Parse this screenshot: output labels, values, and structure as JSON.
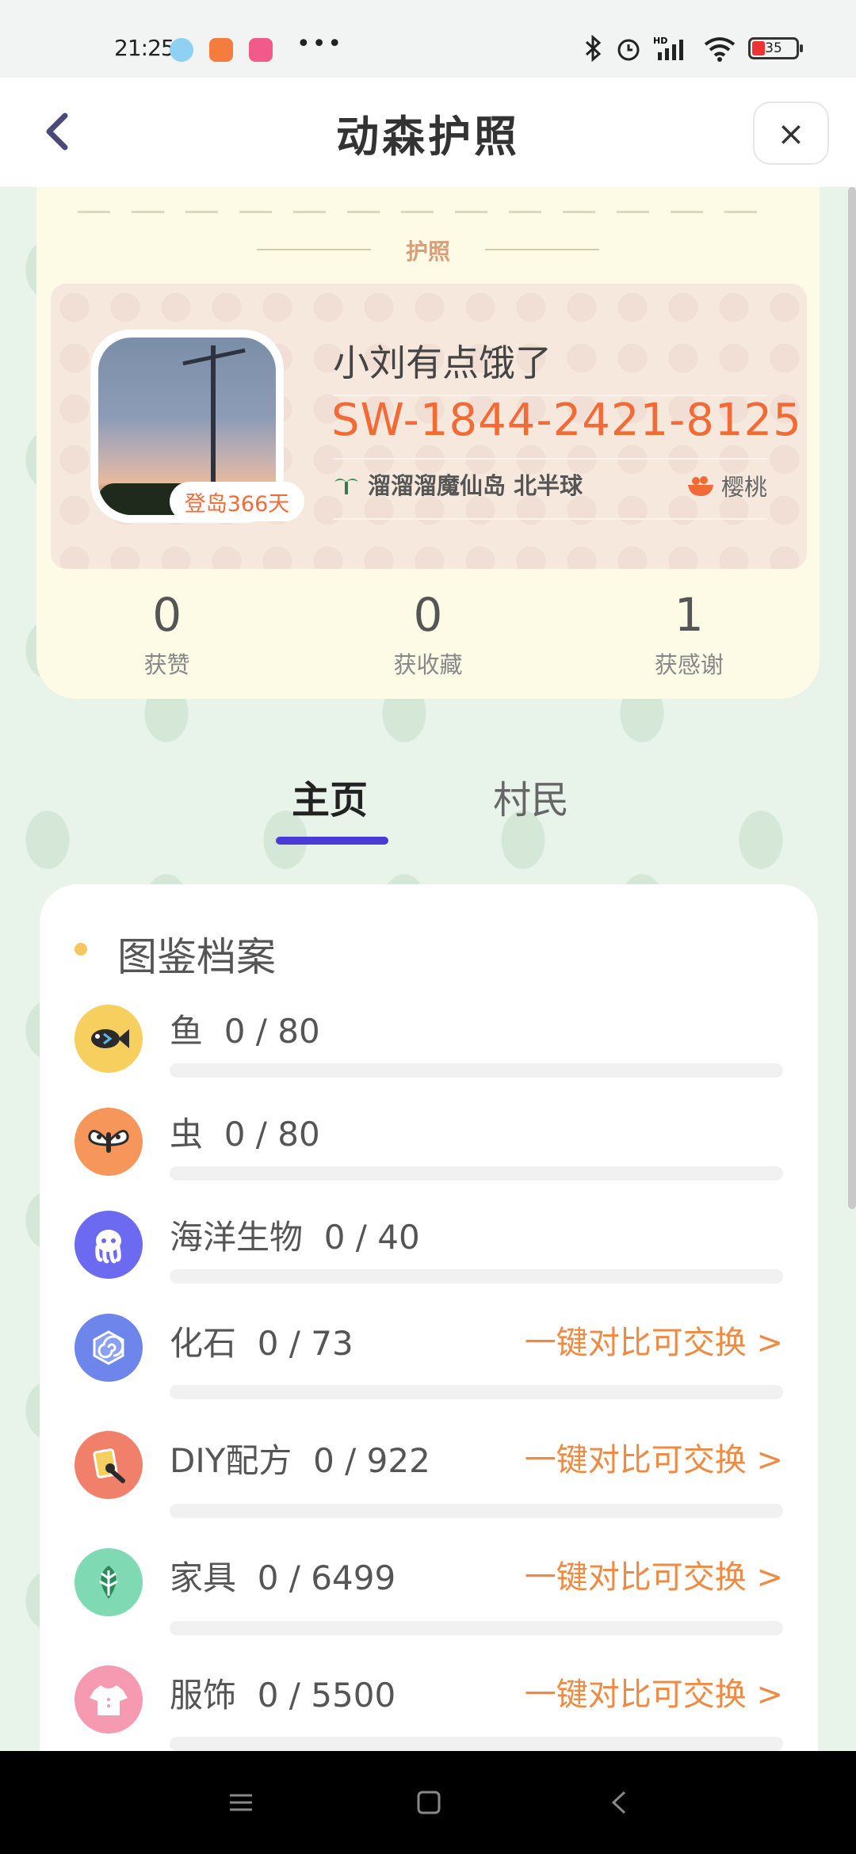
{
  "status_bar": {
    "time": "21:25",
    "battery": "35",
    "more": "•••"
  },
  "header": {
    "title": "动森护照",
    "back_icon": "chevron-left-icon",
    "close_label": "×"
  },
  "passport": {
    "section_label": "护照",
    "player_name": "小刘有点饿了",
    "friend_code": "SW-1844-2421-8125",
    "island": "溜溜溜魔仙岛 北半球",
    "fruit": "樱桃",
    "days_badge": "登岛366天",
    "stats": [
      {
        "value": "0",
        "label": "获赞"
      },
      {
        "value": "0",
        "label": "获收藏"
      },
      {
        "value": "1",
        "label": "获感谢"
      }
    ]
  },
  "tabs": {
    "home": "主页",
    "villagers": "村民"
  },
  "catalog": {
    "title": "图鉴档案",
    "items": [
      {
        "name": "鱼",
        "count": "0 / 80",
        "progress": 0,
        "icon": "fish-icon",
        "color": "#f6cf5e",
        "action": ""
      },
      {
        "name": "虫",
        "count": "0 / 80",
        "progress": 0,
        "icon": "bug-icon",
        "color": "#f6965a",
        "action": ""
      },
      {
        "name": "海洋生物",
        "count": "0 / 40",
        "progress": 0,
        "icon": "octopus-icon",
        "color": "#6c6af0",
        "action": ""
      },
      {
        "name": "化石",
        "count": "0 / 73",
        "progress": 0,
        "icon": "fossil-icon",
        "color": "#6e86ec",
        "action": "一键对比可交换 >"
      },
      {
        "name": "DIY配方",
        "count": "0 / 922",
        "progress": 0,
        "icon": "diy-recipe-icon",
        "color": "#f1806a",
        "action": "一键对比可交换 >"
      },
      {
        "name": "家具",
        "count": "0 / 6499",
        "progress": 0,
        "icon": "leaf-icon",
        "color": "#7fd9b3",
        "action": "一键对比可交换 >"
      },
      {
        "name": "服饰",
        "count": "0 / 5500",
        "progress": 0,
        "icon": "shirt-icon",
        "color": "#f59ab1",
        "action": "一键对比可交换 >"
      }
    ]
  },
  "nav": {
    "menu_icon": "menu-icon",
    "home_icon": "home-square-icon",
    "back_icon": "back-chevron-icon"
  }
}
